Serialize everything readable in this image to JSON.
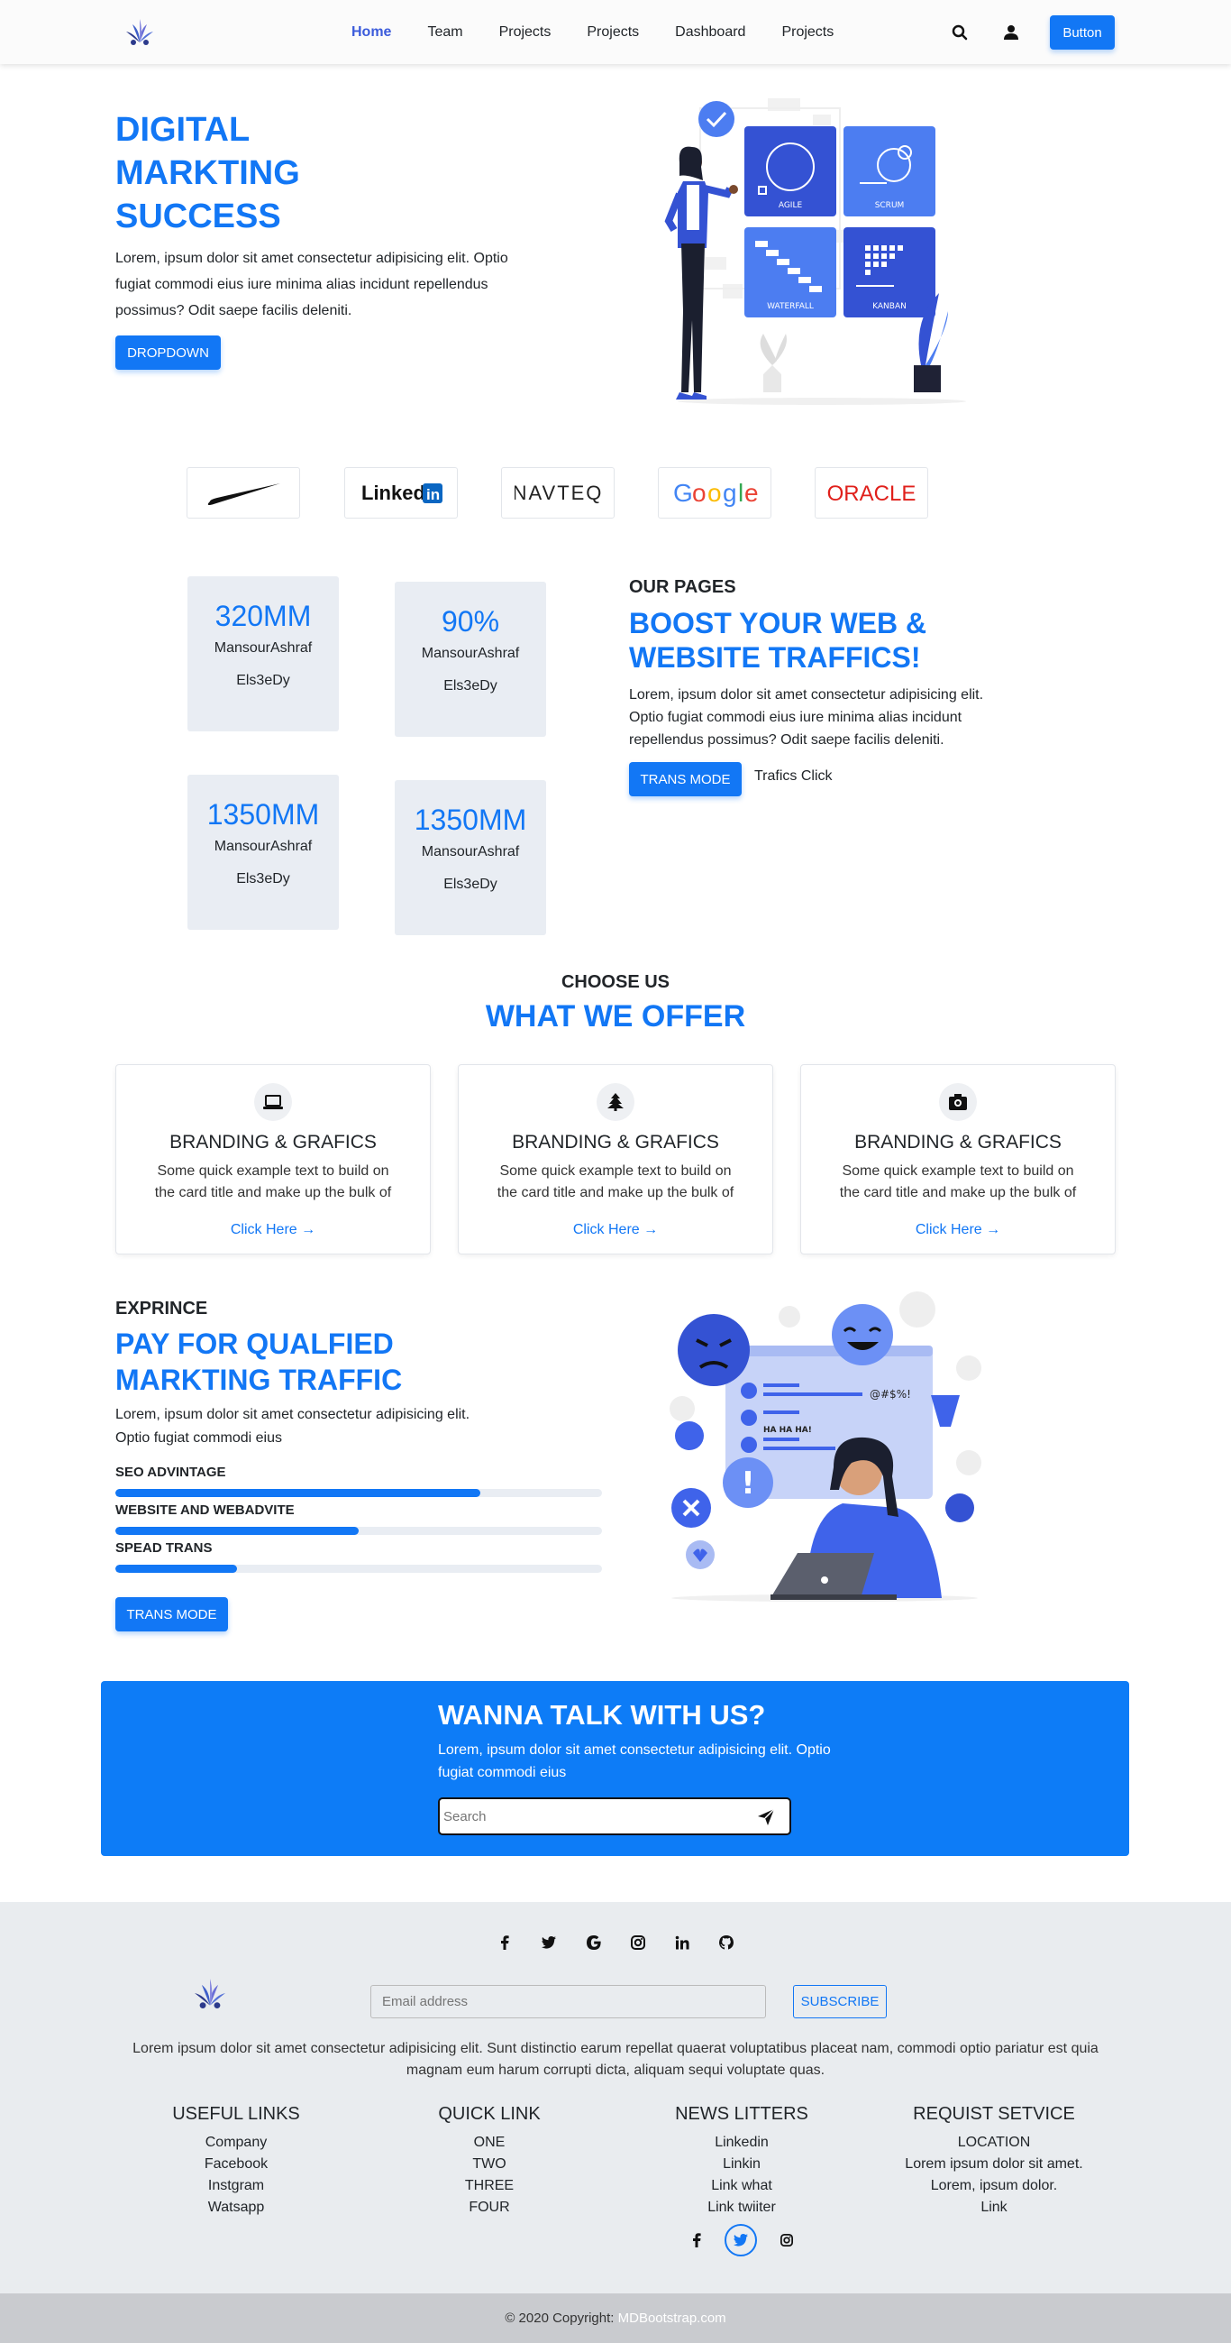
{
  "navbar": {
    "links": [
      "Home",
      "Team",
      "Projects",
      "Projects",
      "Dashboard",
      "Projects"
    ],
    "button": "Button"
  },
  "hero": {
    "title": "DIGITAL MARKTING SUCCESS",
    "text": "Lorem, ipsum dolor sit amet consectetur adipisicing elit. Optio fugiat commodi eius iure minima alias incidunt repellendus possimus? Odit saepe facilis deleniti.",
    "button": "DROPDOWN",
    "illustration": {
      "labels": [
        "AGILE",
        "SCRUM",
        "WATERFALL",
        "KANBAN"
      ]
    }
  },
  "brands": [
    "Nike",
    "LinkedIn",
    "NAVTEQ",
    "Google",
    "ORACLE"
  ],
  "stats": [
    {
      "value": "320MM",
      "name": "MansourAshraf",
      "sub": "Els3eDy"
    },
    {
      "value": "90%",
      "name": "MansourAshraf",
      "sub": "Els3eDy"
    },
    {
      "value": "1350MM",
      "name": "MansourAshraf",
      "sub": "Els3eDy"
    },
    {
      "value": "1350MM",
      "name": "MansourAshraf",
      "sub": "Els3eDy"
    }
  ],
  "boost": {
    "eyebrow": "OUR PAGES",
    "title": "BOOST YOUR WEB & WEBSITE TRAFFICS!",
    "text": "Lorem, ipsum dolor sit amet consectetur adipisicing elit. Optio fugiat commodi eius iure minima alias incidunt repellendus possimus? Odit saepe facilis deleniti.",
    "button": "TRANS MODE",
    "link": "Trafics Click"
  },
  "offer": {
    "eyebrow": "CHOOSE US",
    "title": "WHAT WE OFFER",
    "cards": [
      {
        "icon": "laptop-icon",
        "title": "BRANDING & GRAFICS",
        "text": "Some quick example text to build on the card title and make up the bulk of",
        "link": "Click Here"
      },
      {
        "icon": "tree-icon",
        "title": "BRANDING & GRAFICS",
        "text": "Some quick example text to build on the card title and make up the bulk of",
        "link": "Click Here"
      },
      {
        "icon": "camera-icon",
        "title": "BRANDING & GRAFICS",
        "text": "Some quick example text to build on the card title and make up the bulk of",
        "link": "Click Here"
      }
    ]
  },
  "experience": {
    "eyebrow": "EXPRINCE",
    "title": "PAY FOR QUALFIED MARKTING TRAFFIC",
    "text": "Lorem, ipsum dolor sit amet consectetur adipisicing elit. Optio fugiat commodi eius",
    "skills": [
      {
        "label": "SEO ADVINTAGE",
        "progress": 75
      },
      {
        "label": "WEBSITE AND WEBADVITE",
        "progress": 50
      },
      {
        "label": "SPEAD TRANS",
        "progress": 25
      }
    ],
    "button": "TRANS MODE",
    "illustration": {
      "chat1": "@#$%!",
      "chat2": "HA HA HA!"
    }
  },
  "cta": {
    "title": "WANNA TALK WITH US?",
    "text": "Lorem, ipsum dolor sit amet consectetur adipisicing elit. Optio fugiat commodi eius",
    "placeholder": "Search"
  },
  "footer": {
    "email_placeholder": "Email address",
    "subscribe": "SUBSCRIBE",
    "text": "Lorem ipsum dolor sit amet consectetur adipisicing elit. Sunt distinctio earum repellat quaerat voluptatibus placeat nam, commodi optio pariatur est quia magnam eum harum corrupti dicta, aliquam sequi voluptate quas.",
    "columns": [
      {
        "title": "USEFUL LINKS",
        "items": [
          "Company",
          "Facebook",
          "Instgram",
          "Watsapp"
        ]
      },
      {
        "title": "QUICK LINK",
        "items": [
          "ONE",
          "TWO",
          "THREE",
          "FOUR"
        ]
      },
      {
        "title": "NEWS LITTERS",
        "items": [
          "Linkedin",
          "Linkin",
          "Link what",
          "Link twiiter"
        ]
      },
      {
        "title": "REQUIST SETVICE",
        "items": [
          "LOCATION",
          "Lorem ipsum dolor sit amet.",
          "Lorem, ipsum dolor.",
          "Link"
        ]
      }
    ],
    "copyright_prefix": "© 2020 Copyright:",
    "copyright_link": "MDBootstrap.com"
  }
}
